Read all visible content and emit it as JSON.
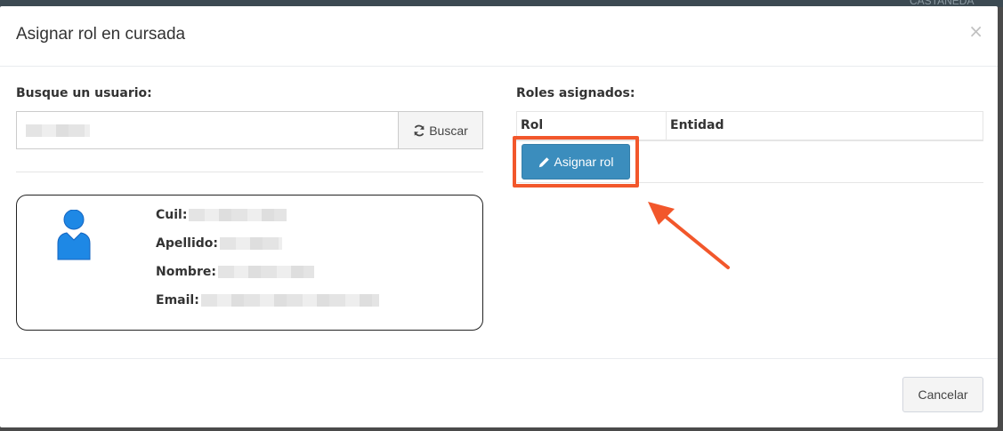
{
  "modal": {
    "title": "Asignar rol en cursada",
    "close_glyph": "×",
    "background_hint": "CASTANEDA"
  },
  "search": {
    "label": "Busque un usuario:",
    "input_value": "",
    "button_label": "Buscar",
    "button_icon": "refresh-icon"
  },
  "user": {
    "avatar_icon": "user-icon",
    "fields": [
      {
        "label": "Cuil:"
      },
      {
        "label": "Apellido:"
      },
      {
        "label": "Nombre:"
      },
      {
        "label": "Email:"
      }
    ]
  },
  "roles": {
    "label": "Roles asignados:",
    "columns": [
      "Rol",
      "Entidad"
    ],
    "assign_button_label": "Asignar rol",
    "assign_button_icon": "pencil-icon"
  },
  "footer": {
    "cancel_label": "Cancelar"
  },
  "colors": {
    "primary": "#3b8dbd",
    "highlight": "#f2572b",
    "avatar": "#1e88e5"
  }
}
